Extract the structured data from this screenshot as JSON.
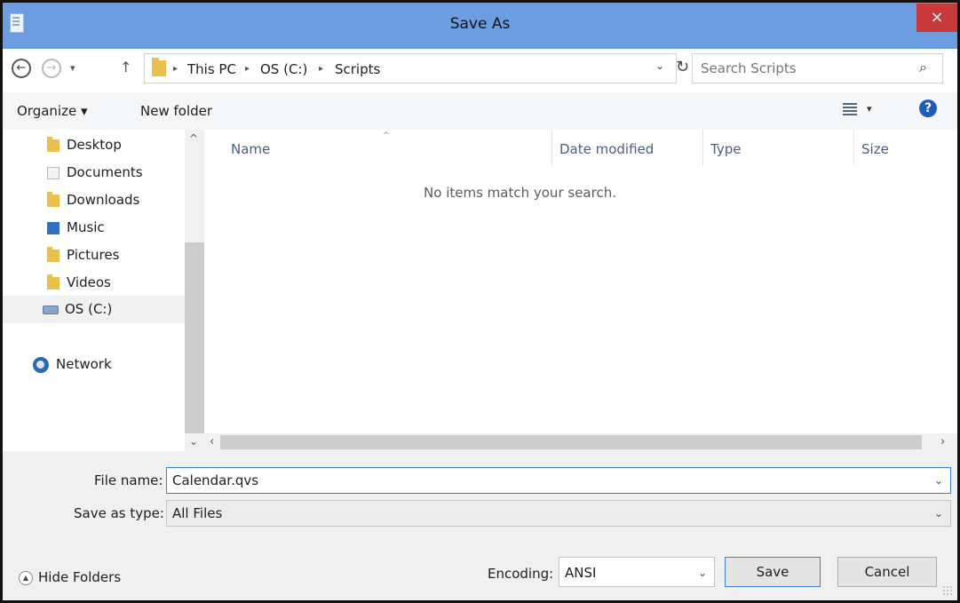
{
  "window": {
    "title": "Save As",
    "close_label": "×"
  },
  "address_bar": {
    "back_glyph": "←",
    "forward_glyph": "→",
    "recent_glyph": "▾",
    "up_glyph": "↑",
    "breadcrumbs": [
      "This PC",
      "OS (C:)",
      "Scripts"
    ],
    "separator": "▸",
    "dropdown_glyph": "⌄",
    "refresh_glyph": "↻"
  },
  "search": {
    "placeholder": "Search Scripts",
    "icon_glyph": "⌕"
  },
  "toolbar": {
    "organize_label": "Organize ▾",
    "new_folder_label": "New folder",
    "view_drop_glyph": "▾",
    "help_glyph": "?"
  },
  "nav_pane": {
    "items": [
      {
        "label": "Desktop",
        "icon": "desktop-icon"
      },
      {
        "label": "Documents",
        "icon": "documents-icon"
      },
      {
        "label": "Downloads",
        "icon": "downloads-icon"
      },
      {
        "label": "Music",
        "icon": "music-icon"
      },
      {
        "label": "Pictures",
        "icon": "pictures-icon"
      },
      {
        "label": "Videos",
        "icon": "videos-icon"
      },
      {
        "label": "OS (C:)",
        "icon": "drive-icon"
      },
      {
        "label": "Network",
        "icon": "network-icon"
      }
    ],
    "scroll_up": "^",
    "scroll_down": "⌄"
  },
  "file_list": {
    "columns": [
      "Name",
      "Date modified",
      "Type",
      "Size"
    ],
    "sort_glyph": "^",
    "empty_message": "No items match your search.",
    "scroll_left": "‹",
    "scroll_right": "›"
  },
  "form": {
    "filename_label": "File name:",
    "filename_value": "Calendar.qvs",
    "savetype_label": "Save as type:",
    "savetype_value": "All Files",
    "dropdown_glyph": "⌄"
  },
  "footer": {
    "hide_folders_label": "Hide Folders",
    "hide_folders_glyph": "▲",
    "encoding_label": "Encoding:",
    "encoding_value": "ANSI",
    "save_label": "Save",
    "cancel_label": "Cancel"
  },
  "colors": {
    "titlebar": "#6b9de0",
    "close": "#c7393a",
    "focus": "#3c7fd1"
  }
}
